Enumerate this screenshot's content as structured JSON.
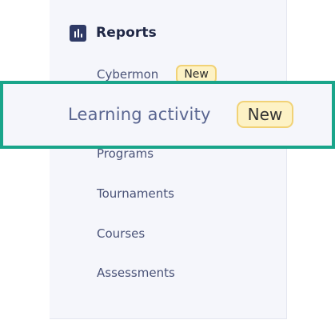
{
  "sidebar": {
    "section": {
      "icon": "bar-chart-icon",
      "title": "Reports"
    },
    "items": [
      {
        "label": "Cybermon",
        "badge": "New"
      },
      {
        "label": "Learning activity",
        "badge": "New",
        "highlighted": true
      },
      {
        "label": "Programs"
      },
      {
        "label": "Tournaments"
      },
      {
        "label": "Courses"
      },
      {
        "label": "Assessments"
      }
    ]
  },
  "colors": {
    "sidebar_bg": "#f5f6fb",
    "section_icon": "#2f3a66",
    "nav_text": "#4a5378",
    "badge_bg": "#fdf2c5",
    "badge_border": "#f1d276",
    "highlight_border": "#19a58a"
  }
}
